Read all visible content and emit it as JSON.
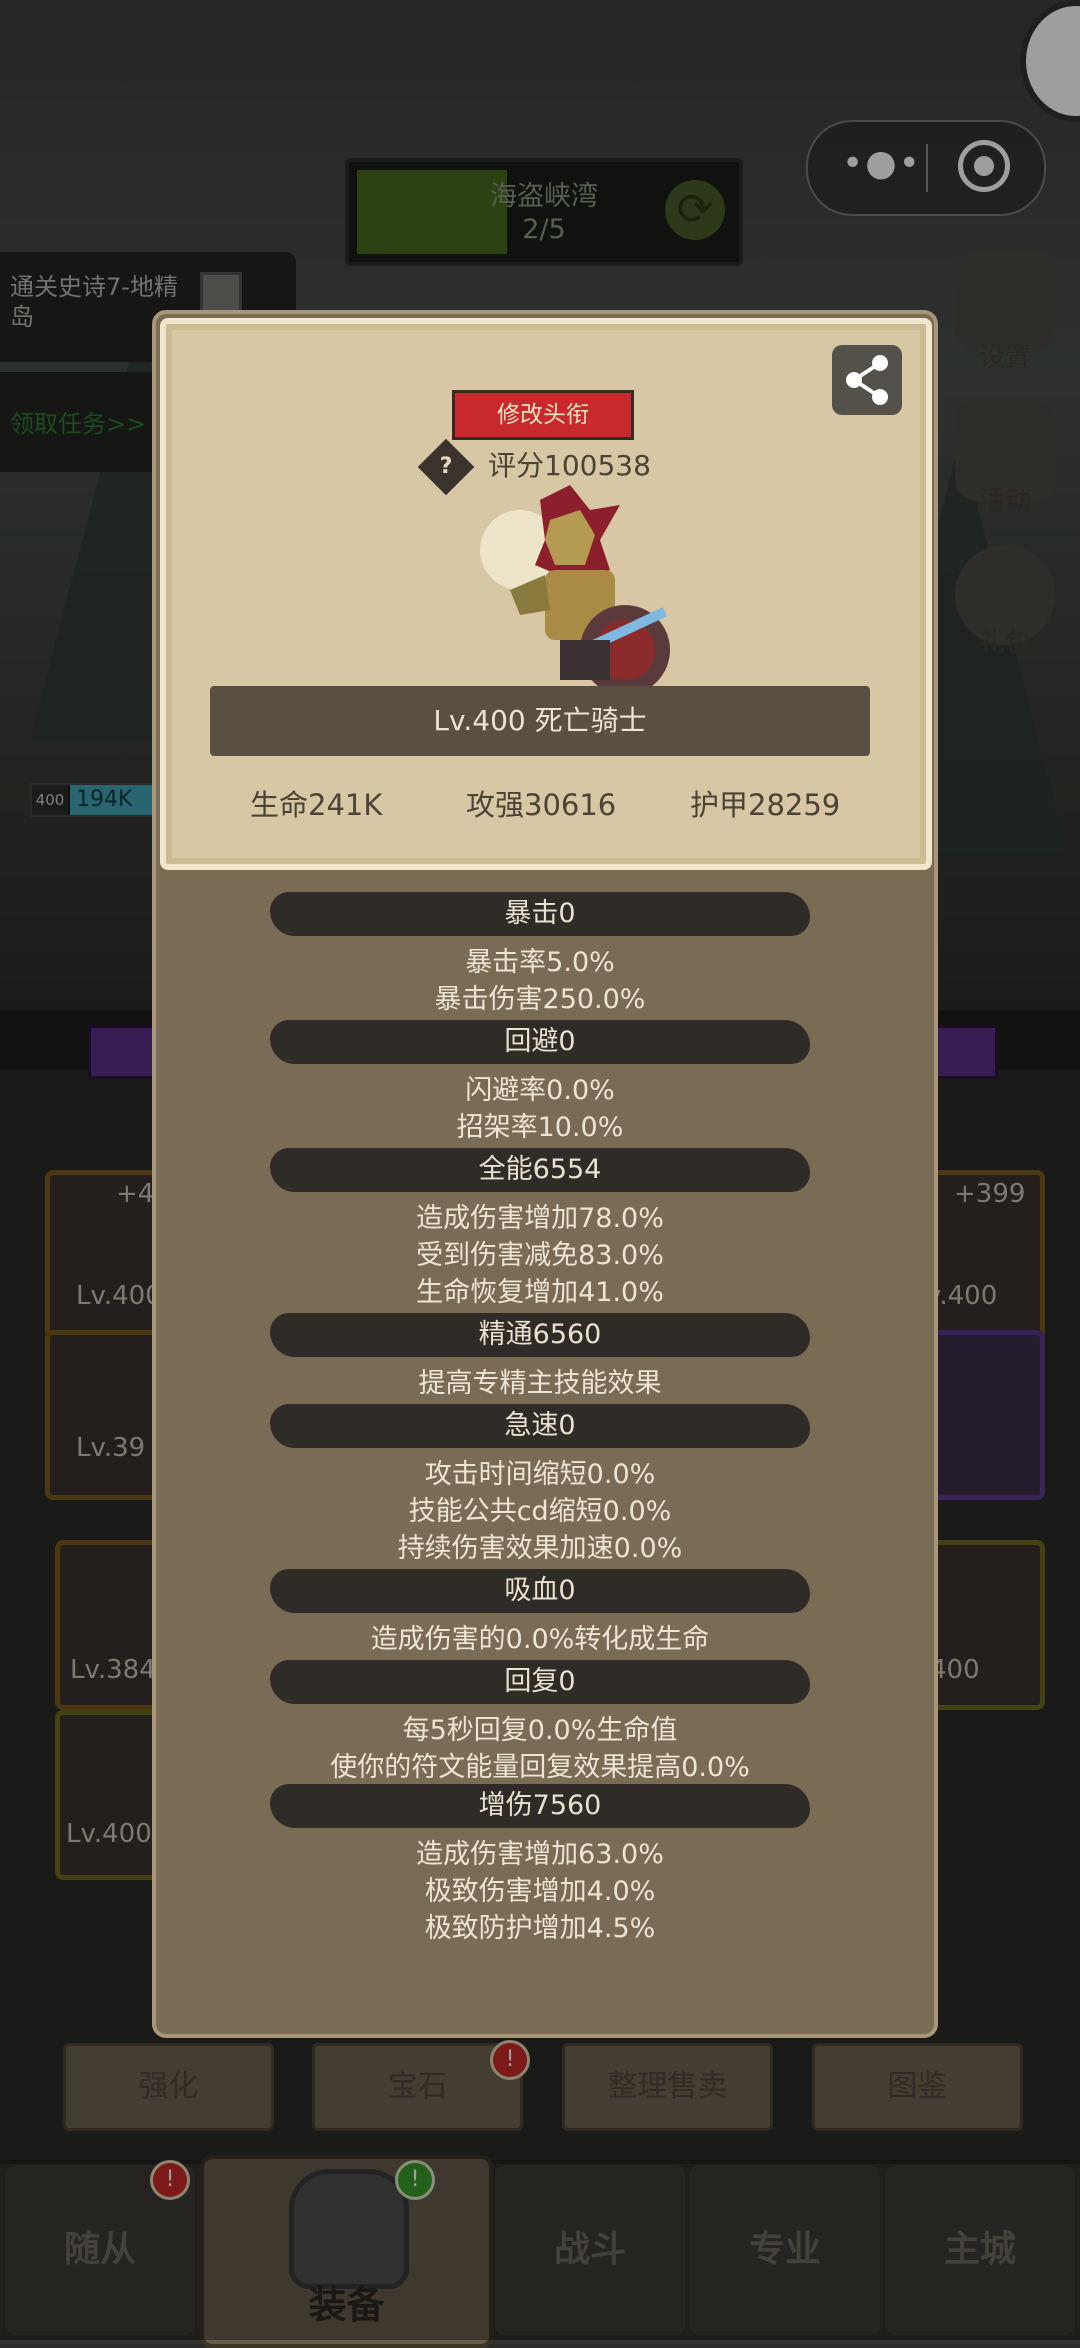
{
  "stage": {
    "name": "海盗峡湾",
    "progress": "2/5"
  },
  "quest": {
    "text": "通关史诗7-地精岛",
    "task_link": "领取任务>>"
  },
  "side_icons": [
    "设置",
    "活动",
    "礼包"
  ],
  "hero_bar": {
    "level": "400",
    "hp": "194K"
  },
  "slots": {
    "top_left_plus": "+4",
    "top_left_lv": "Lv.400",
    "second_left_lv": "Lv.39",
    "top_right_plus": "+399",
    "top_right_lv": "v.400",
    "third_left_lv": "Lv.384",
    "fourth_left_lv": "Lv.400",
    "third_right_lv": "400"
  },
  "actions": [
    "强化",
    "宝石",
    "整理售卖",
    "图鉴"
  ],
  "nav": {
    "items": [
      "随从",
      "装备",
      "战斗",
      "专业",
      "主城"
    ],
    "active": "装备"
  },
  "profile": {
    "edit_title": "修改头衔",
    "score": "评分100538",
    "name": "Lv.400 死亡骑士",
    "stats": [
      "生命241K",
      "攻强30616",
      "护甲28259"
    ]
  },
  "attributes": [
    {
      "title": "暴击0",
      "lines": [
        "暴击率5.0%",
        "暴击伤害250.0%"
      ]
    },
    {
      "title": "回避0",
      "lines": [
        "闪避率0.0%",
        "招架率10.0%"
      ]
    },
    {
      "title": "全能6554",
      "lines": [
        "造成伤害增加78.0%",
        "受到伤害减免83.0%",
        "生命恢复增加41.0%"
      ]
    },
    {
      "title": "精通6560",
      "lines": [
        "提高专精主技能效果"
      ]
    },
    {
      "title": "急速0",
      "lines": [
        "攻击时间缩短0.0%",
        "技能公共cd缩短0.0%",
        "持续伤害效果加速0.0%"
      ]
    },
    {
      "title": "吸血0",
      "lines": [
        "造成伤害的0.0%转化成生命"
      ]
    },
    {
      "title": "回复0",
      "lines": [
        "每5秒回复0.0%生命值",
        "使你的符文能量回复效果提高0.0%"
      ]
    },
    {
      "title": "增伤7560",
      "lines": [
        "造成伤害增加63.0%",
        "极致伤害增加4.0%",
        "极致防护增加4.5%"
      ]
    }
  ],
  "colors": {
    "accent_red": "#c8292d",
    "panel": "#7a6b55",
    "card": "#d7c7a5"
  }
}
